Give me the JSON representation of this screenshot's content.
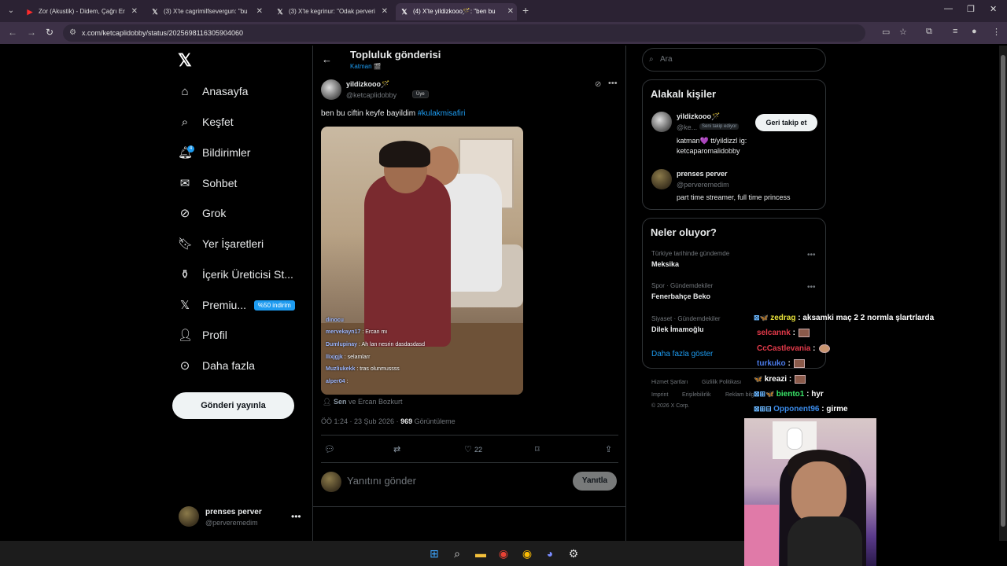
{
  "browser": {
    "tabs": [
      {
        "title": "Zor (Akustik) - Didem, Çağrı Er",
        "icon": "youtube-icon",
        "active": false
      },
      {
        "title": "(3) X'te cagrimilfsevergun: \"bu",
        "icon": "x-icon",
        "active": false
      },
      {
        "title": "(3) X'te kegrinur: \"Odak perveri",
        "icon": "x-icon",
        "active": false
      },
      {
        "title": "(4) X'te yildizkooo🪄: \"ben bu",
        "icon": "x-icon",
        "active": true
      }
    ],
    "url": "x.com/ketcaplidobby/status/2025698116305904060"
  },
  "sidebar": {
    "logo": "𝕏",
    "items": [
      {
        "label": "Anasayfa",
        "icon": "home-icon",
        "glyph": "⌂"
      },
      {
        "label": "Keşfet",
        "icon": "search-icon",
        "glyph": "⌕"
      },
      {
        "label": "Bildirimler",
        "icon": "bell-icon",
        "glyph": "♪",
        "badge": "4"
      },
      {
        "label": "Sohbet",
        "icon": "mail-icon",
        "glyph": "✉"
      },
      {
        "label": "Grok",
        "icon": "grok-icon",
        "glyph": "⊘"
      },
      {
        "label": "Yer İşaretleri",
        "icon": "bookmark-icon",
        "glyph": "⌑"
      },
      {
        "label": "İçerik Üreticisi St...",
        "icon": "creator-studio-icon",
        "glyph": "⚱"
      },
      {
        "label": "Premiu...",
        "icon": "premium-x-icon",
        "glyph": "𝕏",
        "promo": "%50 indirim"
      },
      {
        "label": "Profil",
        "icon": "profile-icon",
        "glyph": "⚲"
      },
      {
        "label": "Daha fazla",
        "icon": "more-circle-icon",
        "glyph": "⊙"
      }
    ],
    "post_button": "Gönderi yayınla",
    "account": {
      "name": "prenses perver",
      "handle": "@perveremedim"
    }
  },
  "post": {
    "header_title": "Topluluk gönderisi",
    "community": "Katman 🎬",
    "author_name": "yildizkooo🪄",
    "author_handle": "@ketcaplidobby",
    "member_badge": "Üye",
    "text": "ben bu ciftin keyfe bayildim ",
    "hashtag": "#kulakmisafiri",
    "video_chat": [
      {
        "user": "dinocu",
        "msg": ""
      },
      {
        "user": "mervekayn17",
        "msg": ": Ercan mı"
      },
      {
        "user": "Dumlupinay",
        "msg": ": Ah lan nesrin dasdasdasd"
      },
      {
        "user": "llixjgjk",
        "msg": ": selamlarr"
      },
      {
        "user": "Muzliukekk",
        "msg": ": tras olunmussss"
      },
      {
        "user": "alper04",
        "msg": ":"
      }
    ],
    "social_context_bold": "Sen",
    "social_context_rest": " ve Ercan Bozkurt",
    "time": "ÖÖ 1:24 · 23 Şub 2026 · ",
    "views_count": "969",
    "views_label": " Görüntüleme",
    "likes": "22",
    "reply_placeholder": "Yanıtını gönder",
    "reply_button": "Yanıtla"
  },
  "right": {
    "search_placeholder": "Ara",
    "relevant": {
      "title": "Alakalı kişiler",
      "people": [
        {
          "name": "yildizkooo🪄",
          "handle": "@ke...",
          "follows_you": "Seni takip ediyor",
          "button": "Geri takip et",
          "bio": "katman💜 tt/yildizzl ig: ketcaparomalidobby"
        },
        {
          "name": "prenses perver",
          "handle": "@perveremedim",
          "bio": "part time streamer, full time princess"
        }
      ]
    },
    "trends": {
      "title": "Neler oluyor?",
      "items": [
        {
          "category": "Türkiye tarihinde gündemde",
          "name": "Meksika"
        },
        {
          "category": "Spor · Gündemdekiler",
          "name": "Fenerbahçe Beko"
        },
        {
          "category": "Siyaset · Gündemdekiler",
          "name": "Dilek İmamoğlu"
        }
      ],
      "show_more": "Daha fazla göster"
    },
    "footer": [
      "Hizmet Şartları",
      "Gizlilik Politikası",
      "Imprint",
      "Erişilebilirlik",
      "Reklam bilgisi",
      "© 2026 X Corp."
    ]
  },
  "stream_chat": [
    {
      "user": "zedrag",
      "user_color": "#e8e23a",
      "msg": ": aksamki maç 2 2 normla şlartrlarda"
    },
    {
      "user": "selcannk",
      "user_color": "#e33a4a",
      "msg": ":"
    },
    {
      "user": "CcCastlevania",
      "user_color": "#e33a4a",
      "msg": ":"
    },
    {
      "user": "turkuko",
      "user_color": "#4a7ae8",
      "msg": ":"
    },
    {
      "user": "kreazi",
      "user_color": "#ffffff",
      "msg": ":"
    },
    {
      "user": "biento1",
      "user_color": "#3ae86a",
      "msg": ": hyr"
    },
    {
      "user": "Opponent96",
      "user_color": "#3a8ae8",
      "msg": ": girme"
    }
  ]
}
